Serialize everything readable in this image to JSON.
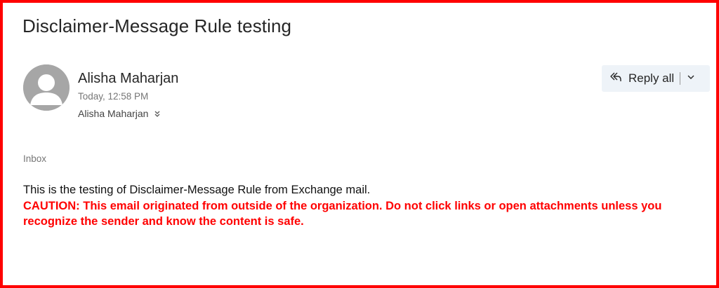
{
  "message": {
    "subject": "Disclaimer-Message Rule testing",
    "sender_name": "Alisha Maharjan",
    "timestamp": "Today, 12:58 PM",
    "recipient": "Alisha Maharjan",
    "folder": "Inbox",
    "body_text": "This is the testing of Disclaimer-Message Rule from Exchange mail.",
    "caution_text": "CAUTION: This email originated from outside of the organization. Do not click links or open attachments unless you recognize the sender and know the content is safe."
  },
  "actions": {
    "reply_all_label": "Reply all",
    "reply_all_icon": "reply-all-icon",
    "dropdown_icon": "chevron-down-icon",
    "expand_recipients_icon": "double-chevron-down-icon"
  },
  "colors": {
    "frame_border": "#ff0000",
    "caution_text": "#ff0000",
    "reply_button_bg": "#eef3f8",
    "avatar_bg": "#a6a6a6"
  }
}
